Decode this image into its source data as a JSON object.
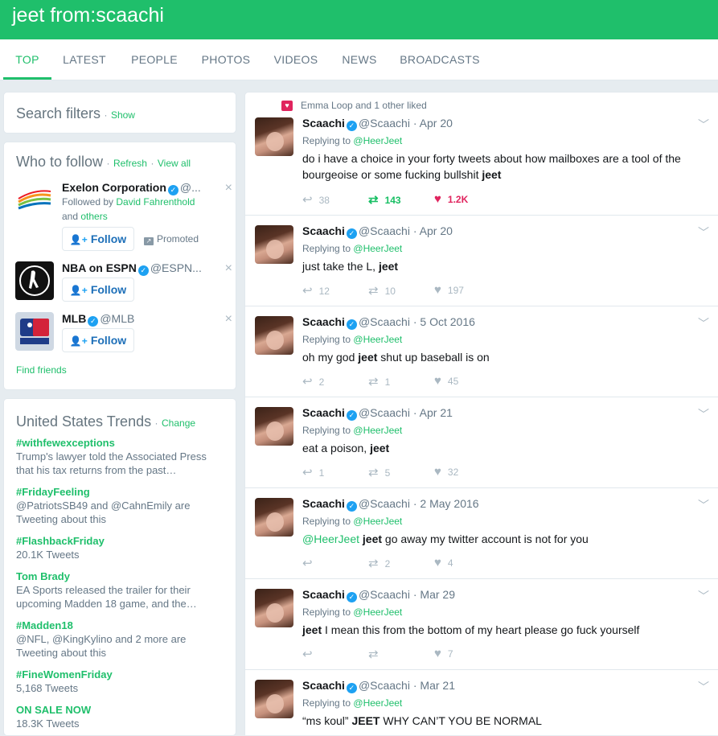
{
  "search": {
    "title": "jeet from:scaachi"
  },
  "tabs": [
    "TOP",
    "LATEST",
    "PEOPLE",
    "PHOTOS",
    "VIDEOS",
    "NEWS",
    "BROADCASTS"
  ],
  "search_filters": {
    "title": "Search filters",
    "sep": "·",
    "action": "Show"
  },
  "who_to_follow": {
    "title": "Who to follow",
    "sep": "·",
    "refresh": "Refresh",
    "view_all": "View all",
    "users": [
      {
        "name": "Exelon Corporation",
        "handle": "@...",
        "followed_by_prefix": "Followed by",
        "followed_by": "David Fahrenthold",
        "and": "and",
        "others": "others",
        "follow": "Follow",
        "promoted": "Promoted"
      },
      {
        "name": "NBA on ESPN",
        "handle": "@ESPN...",
        "follow": "Follow"
      },
      {
        "name": "MLB",
        "handle": "@MLB",
        "follow": "Follow"
      }
    ],
    "find_friends": "Find friends"
  },
  "trends": {
    "title": "United States Trends",
    "sep": "·",
    "change": "Change",
    "items": [
      {
        "name": "#withfewexceptions",
        "desc1": "Trump's lawyer told the Associated Press",
        "desc2": "that his tax returns from the past…"
      },
      {
        "name": "#FridayFeeling",
        "desc1": "@PatriotsSB49 and @CahnEmily are",
        "desc2": "Tweeting about this"
      },
      {
        "name": "#FlashbackFriday",
        "desc1": "20.1K Tweets",
        "desc2": ""
      },
      {
        "name": "Tom Brady",
        "desc1": "EA Sports released the trailer for their",
        "desc2": "upcoming Madden 18 game, and the…"
      },
      {
        "name": "#Madden18",
        "desc1": "@NFL, @KingKylino and 2 more are",
        "desc2": "Tweeting about this"
      },
      {
        "name": "#FineWomenFriday",
        "desc1": "5,168 Tweets",
        "desc2": ""
      },
      {
        "name": "ON SALE NOW",
        "desc1": "18.3K Tweets",
        "desc2": ""
      }
    ]
  },
  "tweets": [
    {
      "context": "Emma Loop and 1 other liked",
      "name": "Scaachi",
      "handle": "@Scaachi",
      "date": "· Apr 20",
      "reply_prefix": "Replying to",
      "reply_to": "@HeerJeet",
      "text_parts": [
        "do i have a choice in your forty tweets about how mailboxes are a tool of the bourgeoise or some fucking bullshit ",
        "jeet",
        ""
      ],
      "replies": "38",
      "retweets": "143",
      "likes": "1.2K"
    },
    {
      "name": "Scaachi",
      "handle": "@Scaachi",
      "date": "· Apr 20",
      "reply_prefix": "Replying to",
      "reply_to": "@HeerJeet",
      "text_parts": [
        "just take the L, ",
        "jeet",
        ""
      ],
      "replies": "12",
      "retweets": "10",
      "likes": "197"
    },
    {
      "name": "Scaachi",
      "handle": "@Scaachi",
      "date": "· 5 Oct 2016",
      "reply_prefix": "Replying to",
      "reply_to": "@HeerJeet",
      "text_parts": [
        "oh my god ",
        "jeet",
        " shut up baseball is on"
      ],
      "replies": "2",
      "retweets": "1",
      "likes": "45"
    },
    {
      "name": "Scaachi",
      "handle": "@Scaachi",
      "date": "· Apr 21",
      "reply_prefix": "Replying to",
      "reply_to": "@HeerJeet",
      "text_parts": [
        "eat a poison, ",
        "jeet",
        ""
      ],
      "replies": "1",
      "retweets": "5",
      "likes": "32"
    },
    {
      "name": "Scaachi",
      "handle": "@Scaachi",
      "date": "· 2 May 2016",
      "reply_prefix": "Replying to",
      "reply_to": "@HeerJeet",
      "mention": "@HeerJeet",
      "text_parts": [
        " ",
        "jeet",
        " go away my twitter account is not for you"
      ],
      "replies": "",
      "retweets": "2",
      "likes": "4"
    },
    {
      "name": "Scaachi",
      "handle": "@Scaachi",
      "date": "· Mar 29",
      "reply_prefix": "Replying to",
      "reply_to": "@HeerJeet",
      "text_parts": [
        "",
        "jeet",
        " I mean this from the bottom of my heart please go fuck yourself"
      ],
      "replies": "",
      "retweets": "",
      "likes": "7"
    },
    {
      "name": "Scaachi",
      "handle": "@Scaachi",
      "date": "· Mar 21",
      "reply_prefix": "Replying to",
      "reply_to": "@HeerJeet",
      "text_parts": [
        "“ms koul” ",
        "JEET",
        " WHY CAN’T YOU BE NORMAL"
      ],
      "replies": "",
      "retweets": "",
      "likes": ""
    }
  ],
  "icons": {
    "reply": "reply-icon",
    "retweet": "retweet-icon",
    "like": "heart-icon",
    "verified": "verified-badge-icon",
    "chevron": "chevron-down-icon",
    "close": "close-icon",
    "follow": "add-user-icon"
  },
  "colors": {
    "brand": "#1fbf6b",
    "like": "#e0245e",
    "retweet": "#17bf63",
    "verified": "#1da1f2"
  }
}
